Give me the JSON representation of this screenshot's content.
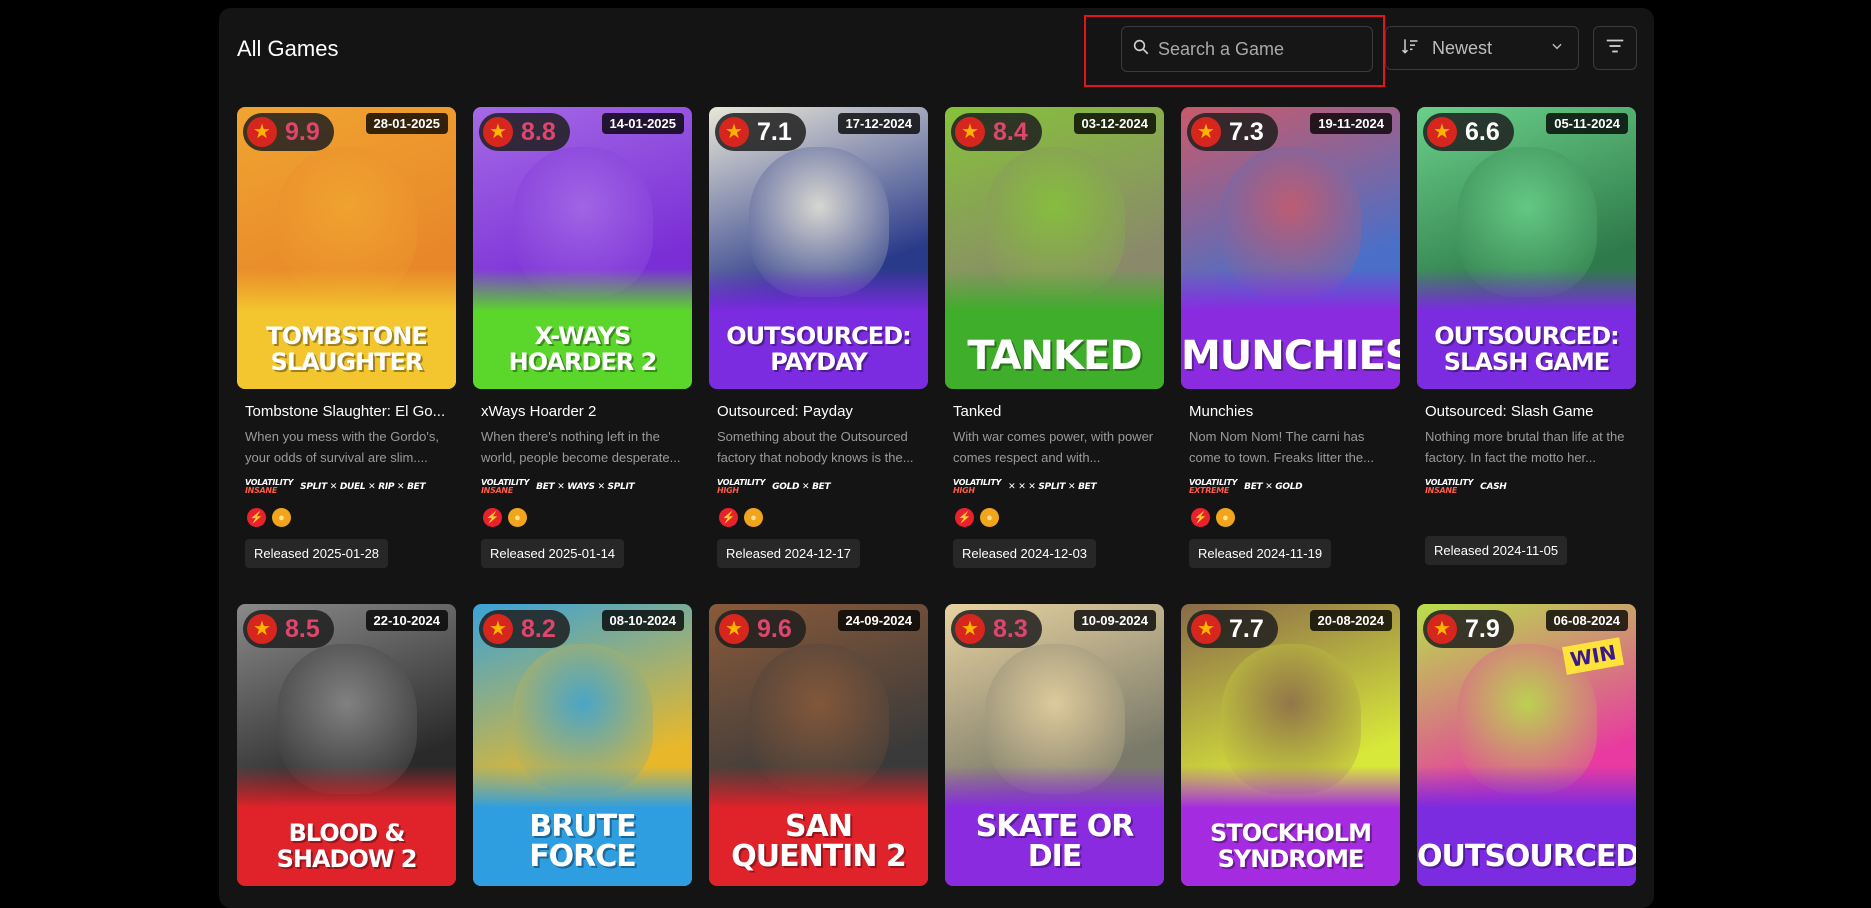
{
  "header": {
    "title": "All Games",
    "search_placeholder": "Search a Game",
    "sort_label": "Newest"
  },
  "icons": {
    "search": "search-icon",
    "sort": "sort-descending-icon",
    "chevron": "chevron-down-icon",
    "filter": "filter-icon",
    "star": "star-icon",
    "bolt": "bolt-icon",
    "coin": "coin-icon"
  },
  "games_row1": [
    {
      "rating": "9.9",
      "rating_color": "#e0456d",
      "date": "28-01-2025",
      "poster_text": "TOMBSTONE SLAUGHTER",
      "name": "Tombstone Slaughter: El Go...",
      "desc": "When you mess with the Gordo's, your odds of survival are slim....",
      "volatility": "INSANE",
      "features": "SPLIT ✕ DUEL ✕ RIP ✕ BET",
      "released": "Released 2025-01-28",
      "bg": "#e8872a",
      "accent": "#f0a530",
      "splat": "#f3c52e"
    },
    {
      "rating": "8.8",
      "rating_color": "#e0456d",
      "date": "14-01-2025",
      "poster_text": "X-WAYS HOARDER 2",
      "name": "xWays Hoarder 2",
      "desc": "When there's nothing left in the world, people become desperate...",
      "volatility": "INSANE",
      "features": "BET ✕ WAYS ✕ SPLIT",
      "released": "Released 2025-01-14",
      "bg": "#7a2fd6",
      "accent": "#a56ae6",
      "splat": "#5bd62b"
    },
    {
      "rating": "7.1",
      "rating_color": "#ffffff",
      "date": "17-12-2024",
      "poster_text": "OUTSOURCED: PAYDAY",
      "name": "Outsourced: Payday",
      "desc": "Something about the Outsourced factory that nobody knows is the...",
      "volatility": "HIGH",
      "features": "GOLD ✕ BET",
      "released": "Released 2024-12-17",
      "bg": "#2a3a8a",
      "accent": "#e9e7d8",
      "splat": "#7b2be0"
    },
    {
      "rating": "8.4",
      "rating_color": "#e0456d",
      "date": "03-12-2024",
      "poster_text": "TANKED",
      "name": "Tanked",
      "desc": "With war comes power, with power comes respect and with...",
      "volatility": "HIGH",
      "features": "✕ ✕ ✕ SPLIT ✕ BET",
      "released": "Released 2024-12-03",
      "bg": "#8a8a6a",
      "accent": "#86c23a",
      "splat": "#3fae2a"
    },
    {
      "rating": "7.3",
      "rating_color": "#ffffff",
      "date": "19-11-2024",
      "poster_text": "MUNCHIES",
      "name": "Munchies",
      "desc": "Nom Nom Nom! The carni has come to town. Freaks litter the...",
      "volatility": "EXTREME",
      "features": "BET ✕ GOLD",
      "released": "Released 2024-11-19",
      "bg": "#4a6fc8",
      "accent": "#c95a6a",
      "splat": "#8a2be0"
    },
    {
      "rating": "6.6",
      "rating_color": "#ffffff",
      "date": "05-11-2024",
      "poster_text": "OUTSOURCED: SLASH GAME",
      "name": "Outsourced: Slash Game",
      "desc": "Nothing more brutal than life at the factory. In fact the motto her...",
      "volatility": "INSANE",
      "features": "CASH",
      "released": "Released 2024-11-05",
      "bg": "#2f7a4a",
      "accent": "#6ad08a",
      "splat": "#7b2be0"
    }
  ],
  "games_row2": [
    {
      "rating": "8.5",
      "rating_color": "#e0456d",
      "date": "22-10-2024",
      "poster_text": "BLOOD & SHADOW 2",
      "bg": "#2a2a2a",
      "accent": "#8a8a8a",
      "splat": "#e0232a"
    },
    {
      "rating": "8.2",
      "rating_color": "#e0456d",
      "date": "08-10-2024",
      "poster_text": "BRUTE FORCE",
      "bg": "#e8b82a",
      "accent": "#3aa3d8",
      "splat": "#2e9ee0"
    },
    {
      "rating": "9.6",
      "rating_color": "#e0456d",
      "date": "24-09-2024",
      "poster_text": "SAN QUENTIN 2",
      "bg": "#3a3a3a",
      "accent": "#8a5a3a",
      "splat": "#e0232a"
    },
    {
      "rating": "8.3",
      "rating_color": "#e0456d",
      "date": "10-09-2024",
      "poster_text": "SKATE OR DIE",
      "bg": "#7a7a6a",
      "accent": "#e8d2a0",
      "splat": "#8a2be0"
    },
    {
      "rating": "7.7",
      "rating_color": "#ffffff",
      "date": "20-08-2024",
      "poster_text": "STOCKHOLM SYNDROME",
      "bg": "#d8e83a",
      "accent": "#8a6a4a",
      "splat": "#a52be0"
    },
    {
      "rating": "7.9",
      "rating_color": "#ffffff",
      "date": "06-08-2024",
      "poster_text": "OUTSOURCED",
      "win": "WIN",
      "bg": "#e83aa0",
      "accent": "#b8e04a",
      "splat": "#7b2be0"
    }
  ]
}
